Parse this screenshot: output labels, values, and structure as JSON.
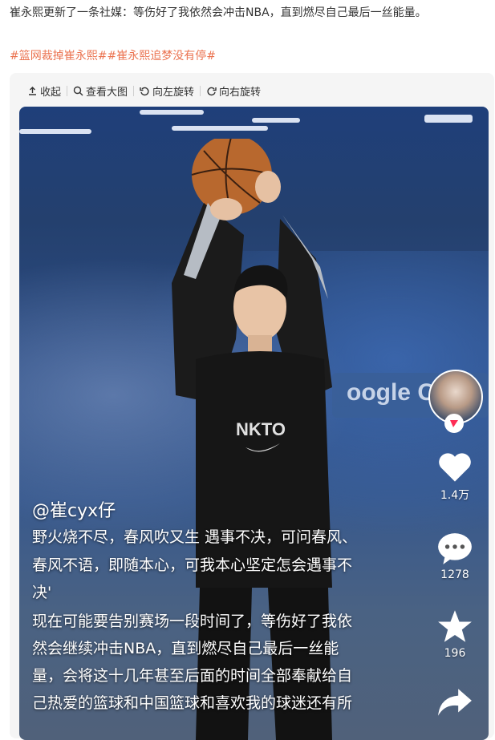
{
  "post": {
    "text": "崔永熙更新了一条社媒：等伤好了我依然会冲击NBA，直到燃尽自己最后一丝能量。",
    "tags": [
      "#篮网裁掉崔永熙#",
      "#崔永熙追梦没有停#"
    ]
  },
  "toolbar": {
    "collapse_label": "收起",
    "view_large_label": "查看大图",
    "rotate_left_label": "向左旋转",
    "rotate_right_label": "向右旋转"
  },
  "image": {
    "banner_text": "oogle Cl",
    "handle": "@崔cyx仔",
    "caption_line1": "野火烧不尽，春风吹又生 遇事不决，可问春风、",
    "caption_line2": "春风不语，即随本心，可我本心坚定怎会遇事不",
    "caption_line3": "决'",
    "caption_line4": "现在可能要告别赛场一段时间了，等伤好了我依",
    "caption_line5": "然会继续冲击NBA，直到燃尽自己最后一丝能",
    "caption_line6": "量，会将这十几年甚至后面的时间全部奉献给自",
    "caption_line7": "己热爱的篮球和中国篮球和喜欢我的球迷还有所",
    "likes": "1.4万",
    "comments": "1278",
    "favorites": "196"
  },
  "colors": {
    "tag": "#eb7350",
    "text": "#333333",
    "card_bg": "#f5f5f5"
  }
}
